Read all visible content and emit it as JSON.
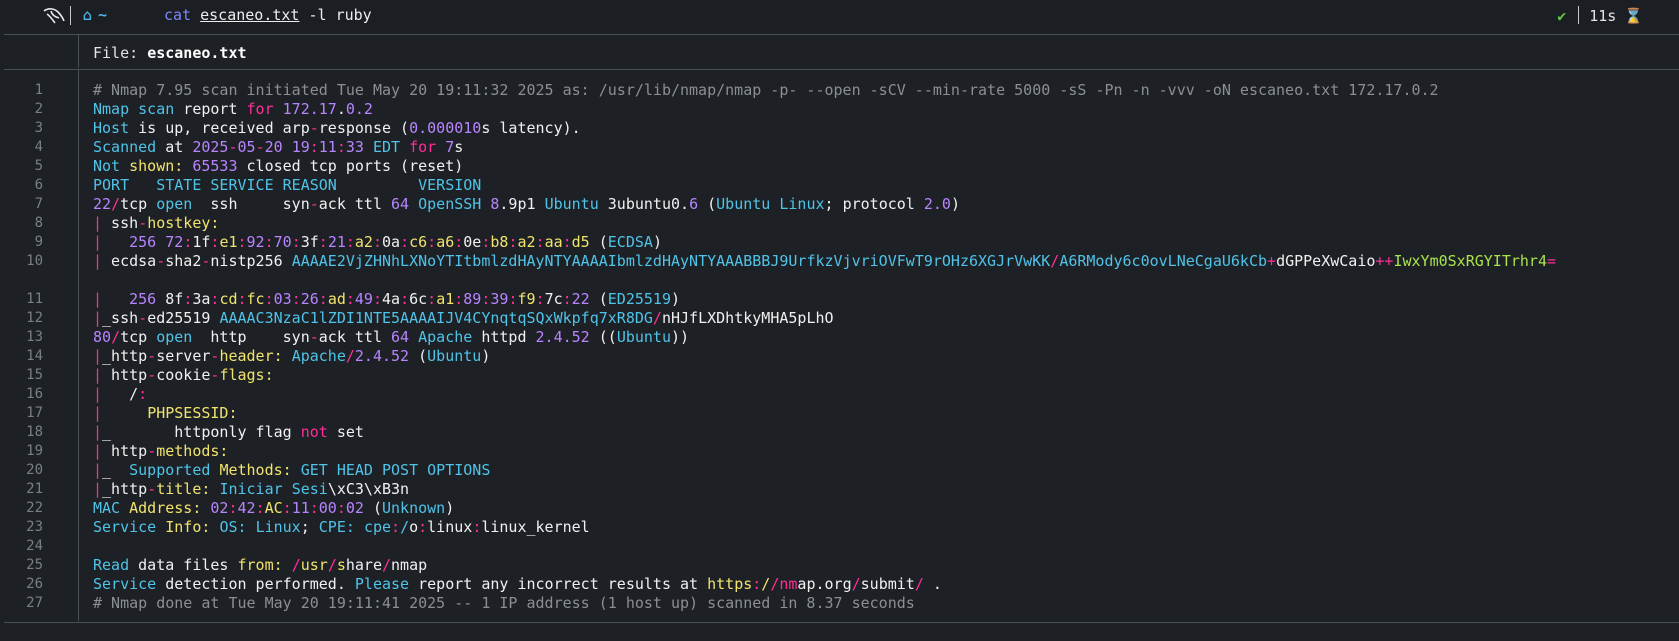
{
  "prompt": {
    "home_icon": "home-icon",
    "tilde": "~",
    "command_cat": "cat",
    "command_file": "escaneo.txt",
    "command_args": " -l ruby",
    "status_check": "✔",
    "duration": "11s",
    "hourglass": "⌛"
  },
  "viewer": {
    "file_label": "File: ",
    "file_name": "escaneo.txt"
  },
  "colors": {
    "keyword": "#4fc3e8",
    "operator": "#ff2e97",
    "number": "#b984ff",
    "property": "#f2e36c",
    "string": "#a9e34b",
    "comment": "#8b8f94"
  },
  "lines": [
    {
      "n": "1",
      "t": [
        [
          "cm",
          "# Nmap 7.95 scan initiated Tue May 20 19:11:32 2025 as: /usr/lib/nmap/nmap -p- --open -sCV --min-rate 5000 -sS -Pn -n -vvv -oN escaneo.txt 172.17.0.2"
        ]
      ]
    },
    {
      "n": "2",
      "t": [
        [
          "k",
          "Nmap"
        ],
        [
          "w",
          " "
        ],
        [
          "k",
          "scan"
        ],
        [
          "w",
          " report "
        ],
        [
          "m",
          "for"
        ],
        [
          "w",
          " "
        ],
        [
          "n",
          "172.17"
        ],
        [
          "w",
          "."
        ],
        [
          "n",
          "0.2"
        ]
      ]
    },
    {
      "n": "3",
      "t": [
        [
          "k",
          "Host"
        ],
        [
          "w",
          " is up, received arp"
        ],
        [
          "m",
          "-"
        ],
        [
          "w",
          "response ("
        ],
        [
          "n",
          "0.000010"
        ],
        [
          "w",
          "s latency)."
        ]
      ]
    },
    {
      "n": "4",
      "t": [
        [
          "k",
          "Scanned"
        ],
        [
          "w",
          " at "
        ],
        [
          "n",
          "2025"
        ],
        [
          "m",
          "-"
        ],
        [
          "n",
          "05"
        ],
        [
          "m",
          "-"
        ],
        [
          "n",
          "20"
        ],
        [
          "w",
          " "
        ],
        [
          "n",
          "19"
        ],
        [
          "m",
          ":"
        ],
        [
          "n",
          "11"
        ],
        [
          "m",
          ":"
        ],
        [
          "n",
          "33"
        ],
        [
          "w",
          " "
        ],
        [
          "k",
          "EDT"
        ],
        [
          "w",
          " "
        ],
        [
          "m",
          "for"
        ],
        [
          "w",
          " "
        ],
        [
          "n",
          "7"
        ],
        [
          "w",
          "s"
        ]
      ]
    },
    {
      "n": "5",
      "t": [
        [
          "k",
          "Not"
        ],
        [
          "w",
          " "
        ],
        [
          "y",
          "shown:"
        ],
        [
          "w",
          " "
        ],
        [
          "n",
          "65533"
        ],
        [
          "w",
          " closed tcp ports (reset)"
        ]
      ]
    },
    {
      "n": "6",
      "t": [
        [
          "k",
          "PORT   STATE SERVICE REASON         VERSION"
        ]
      ]
    },
    {
      "n": "7",
      "t": [
        [
          "n",
          "22"
        ],
        [
          "m",
          "/"
        ],
        [
          "w",
          "tcp "
        ],
        [
          "k",
          "open"
        ],
        [
          "w",
          "  ssh     syn"
        ],
        [
          "m",
          "-"
        ],
        [
          "w",
          "ack ttl "
        ],
        [
          "n",
          "64"
        ],
        [
          "w",
          " "
        ],
        [
          "k",
          "OpenSSH"
        ],
        [
          "w",
          " "
        ],
        [
          "n",
          "8"
        ],
        [
          "w",
          ".9p1 "
        ],
        [
          "k",
          "Ubuntu"
        ],
        [
          "w",
          " 3ubuntu0."
        ],
        [
          "n",
          "6"
        ],
        [
          "w",
          " ("
        ],
        [
          "k",
          "Ubuntu"
        ],
        [
          "w",
          " "
        ],
        [
          "k",
          "Linux"
        ],
        [
          "w",
          "; protocol "
        ],
        [
          "n",
          "2.0"
        ],
        [
          "w",
          ")"
        ]
      ]
    },
    {
      "n": "8",
      "t": [
        [
          "m",
          "|"
        ],
        [
          "w",
          " ssh"
        ],
        [
          "m",
          "-"
        ],
        [
          "y",
          "hostkey:"
        ]
      ]
    },
    {
      "n": "9",
      "t": [
        [
          "m",
          "|"
        ],
        [
          "w",
          "   "
        ],
        [
          "n",
          "256"
        ],
        [
          "w",
          " "
        ],
        [
          "n",
          "72"
        ],
        [
          "m",
          ":"
        ],
        [
          "w",
          "1f"
        ],
        [
          "m",
          ":"
        ],
        [
          "y",
          "e1"
        ],
        [
          "m",
          ":"
        ],
        [
          "n",
          "92"
        ],
        [
          "m",
          ":"
        ],
        [
          "n",
          "70"
        ],
        [
          "m",
          ":"
        ],
        [
          "w",
          "3f"
        ],
        [
          "m",
          ":"
        ],
        [
          "n",
          "21"
        ],
        [
          "m",
          ":"
        ],
        [
          "y",
          "a2"
        ],
        [
          "m",
          ":"
        ],
        [
          "w",
          "0a"
        ],
        [
          "m",
          ":"
        ],
        [
          "y",
          "c6"
        ],
        [
          "m",
          ":"
        ],
        [
          "y",
          "a6"
        ],
        [
          "m",
          ":"
        ],
        [
          "w",
          "0e"
        ],
        [
          "m",
          ":"
        ],
        [
          "y",
          "b8"
        ],
        [
          "m",
          ":"
        ],
        [
          "y",
          "a2"
        ],
        [
          "m",
          ":"
        ],
        [
          "y",
          "aa"
        ],
        [
          "m",
          ":"
        ],
        [
          "y",
          "d5"
        ],
        [
          "w",
          " ("
        ],
        [
          "k",
          "ECDSA"
        ],
        [
          "w",
          ")"
        ]
      ]
    },
    {
      "n": "10",
      "tall": true,
      "t": [
        [
          "m",
          "|"
        ],
        [
          "w",
          " ecdsa"
        ],
        [
          "m",
          "-"
        ],
        [
          "w",
          "sha2"
        ],
        [
          "m",
          "-"
        ],
        [
          "w",
          "nistp256 "
        ],
        [
          "k",
          "AAAAE2VjZHNhLXNoYTItbmlzdHAyNTYAAAAIbmlzdHAyNTYAAABBBJ9UrfkzVjvriOVFwT9rOHz6XGJrVwKK"
        ],
        [
          "m",
          "/"
        ],
        [
          "k",
          "A6RMody6c0ovLNeCgaU6kCb"
        ],
        [
          "m",
          "+"
        ],
        [
          "w",
          "dGPPeXwCaio"
        ],
        [
          "m",
          "++"
        ],
        [
          "g",
          "IwxYm0SxRGYITrhr4"
        ],
        [
          "m",
          "="
        ]
      ]
    },
    {
      "n": "11",
      "t": [
        [
          "m",
          "|"
        ],
        [
          "w",
          "   "
        ],
        [
          "n",
          "256"
        ],
        [
          "w",
          " 8f"
        ],
        [
          "m",
          ":"
        ],
        [
          "w",
          "3a"
        ],
        [
          "m",
          ":"
        ],
        [
          "y",
          "cd"
        ],
        [
          "m",
          ":"
        ],
        [
          "y",
          "fc"
        ],
        [
          "m",
          ":"
        ],
        [
          "n",
          "03"
        ],
        [
          "m",
          ":"
        ],
        [
          "n",
          "26"
        ],
        [
          "m",
          ":"
        ],
        [
          "y",
          "ad"
        ],
        [
          "m",
          ":"
        ],
        [
          "n",
          "49"
        ],
        [
          "m",
          ":"
        ],
        [
          "w",
          "4a"
        ],
        [
          "m",
          ":"
        ],
        [
          "w",
          "6c"
        ],
        [
          "m",
          ":"
        ],
        [
          "y",
          "a1"
        ],
        [
          "m",
          ":"
        ],
        [
          "n",
          "89"
        ],
        [
          "m",
          ":"
        ],
        [
          "n",
          "39"
        ],
        [
          "m",
          ":"
        ],
        [
          "y",
          "f9"
        ],
        [
          "m",
          ":"
        ],
        [
          "w",
          "7c"
        ],
        [
          "m",
          ":"
        ],
        [
          "n",
          "22"
        ],
        [
          "w",
          " ("
        ],
        [
          "k",
          "ED25519"
        ],
        [
          "w",
          ")"
        ]
      ]
    },
    {
      "n": "12",
      "t": [
        [
          "m",
          "|"
        ],
        [
          "w",
          "_ssh"
        ],
        [
          "m",
          "-"
        ],
        [
          "w",
          "ed25519 "
        ],
        [
          "k",
          "AAAAC3NzaC1lZDI1NTE5AAAAIJV4CYnqtqSQxWkpfq7xR8DG"
        ],
        [
          "m",
          "/"
        ],
        [
          "w",
          "nHJfLXDhtkyMHA5pLhO"
        ]
      ]
    },
    {
      "n": "13",
      "t": [
        [
          "n",
          "80"
        ],
        [
          "m",
          "/"
        ],
        [
          "w",
          "tcp "
        ],
        [
          "k",
          "open"
        ],
        [
          "w",
          "  http    syn"
        ],
        [
          "m",
          "-"
        ],
        [
          "w",
          "ack ttl "
        ],
        [
          "n",
          "64"
        ],
        [
          "w",
          " "
        ],
        [
          "k",
          "Apache"
        ],
        [
          "w",
          " httpd "
        ],
        [
          "n",
          "2.4.52"
        ],
        [
          "w",
          " (("
        ],
        [
          "k",
          "Ubuntu"
        ],
        [
          "w",
          "))"
        ]
      ]
    },
    {
      "n": "14",
      "t": [
        [
          "m",
          "|"
        ],
        [
          "w",
          "_http"
        ],
        [
          "m",
          "-"
        ],
        [
          "w",
          "server"
        ],
        [
          "m",
          "-"
        ],
        [
          "y",
          "header:"
        ],
        [
          "w",
          " "
        ],
        [
          "k",
          "Apache"
        ],
        [
          "m",
          "/"
        ],
        [
          "n",
          "2.4.52"
        ],
        [
          "w",
          " ("
        ],
        [
          "k",
          "Ubuntu"
        ],
        [
          "w",
          ")"
        ]
      ]
    },
    {
      "n": "15",
      "t": [
        [
          "m",
          "|"
        ],
        [
          "w",
          " http"
        ],
        [
          "m",
          "-"
        ],
        [
          "w",
          "cookie"
        ],
        [
          "m",
          "-"
        ],
        [
          "y",
          "flags:"
        ]
      ]
    },
    {
      "n": "16",
      "t": [
        [
          "m",
          "|"
        ],
        [
          "w",
          "   /"
        ],
        [
          "m",
          ":"
        ]
      ]
    },
    {
      "n": "17",
      "t": [
        [
          "m",
          "|"
        ],
        [
          "w",
          "     "
        ],
        [
          "y",
          "PHPSESSID:"
        ]
      ]
    },
    {
      "n": "18",
      "t": [
        [
          "m",
          "|"
        ],
        [
          "w",
          "_       httponly flag "
        ],
        [
          "m",
          "not"
        ],
        [
          "w",
          " set"
        ]
      ]
    },
    {
      "n": "19",
      "t": [
        [
          "m",
          "|"
        ],
        [
          "w",
          " http"
        ],
        [
          "m",
          "-"
        ],
        [
          "y",
          "methods:"
        ]
      ]
    },
    {
      "n": "20",
      "t": [
        [
          "m",
          "|"
        ],
        [
          "w",
          "_  "
        ],
        [
          "k",
          "Supported"
        ],
        [
          "w",
          " "
        ],
        [
          "y",
          "Methods:"
        ],
        [
          "w",
          " "
        ],
        [
          "k",
          "GET HEAD POST OPTIONS"
        ]
      ]
    },
    {
      "n": "21",
      "t": [
        [
          "m",
          "|"
        ],
        [
          "w",
          "_http"
        ],
        [
          "m",
          "-"
        ],
        [
          "y",
          "title:"
        ],
        [
          "w",
          " "
        ],
        [
          "k",
          "Iniciar"
        ],
        [
          "w",
          " "
        ],
        [
          "k",
          "Sesi"
        ],
        [
          "w",
          "\\xC3\\xB3n"
        ]
      ]
    },
    {
      "n": "22",
      "t": [
        [
          "k",
          "MAC"
        ],
        [
          "w",
          " "
        ],
        [
          "y",
          "Address:"
        ],
        [
          "w",
          " "
        ],
        [
          "n",
          "02"
        ],
        [
          "m",
          ":"
        ],
        [
          "n",
          "42"
        ],
        [
          "m",
          ":"
        ],
        [
          "y",
          "AC"
        ],
        [
          "m",
          ":"
        ],
        [
          "n",
          "11"
        ],
        [
          "m",
          ":"
        ],
        [
          "n",
          "00"
        ],
        [
          "m",
          ":"
        ],
        [
          "n",
          "02"
        ],
        [
          "w",
          " ("
        ],
        [
          "k",
          "Unknown"
        ],
        [
          "w",
          ")"
        ]
      ]
    },
    {
      "n": "23",
      "t": [
        [
          "k",
          "Service"
        ],
        [
          "w",
          " "
        ],
        [
          "y",
          "Info:"
        ],
        [
          "w",
          " "
        ],
        [
          "k",
          "OS:"
        ],
        [
          "w",
          " "
        ],
        [
          "k",
          "Linux"
        ],
        [
          "w",
          "; "
        ],
        [
          "k",
          "CPE:"
        ],
        [
          "w",
          " "
        ],
        [
          "k",
          "cpe"
        ],
        [
          "m",
          ":"
        ],
        [
          "k",
          "/"
        ],
        [
          "w",
          "o"
        ],
        [
          "m",
          ":"
        ],
        [
          "w",
          "linux"
        ],
        [
          "m",
          ":"
        ],
        [
          "w",
          "linux_kernel"
        ]
      ]
    },
    {
      "n": "24",
      "t": []
    },
    {
      "n": "25",
      "t": [
        [
          "k",
          "Read"
        ],
        [
          "w",
          " data files "
        ],
        [
          "y",
          "from:"
        ],
        [
          "w",
          " "
        ],
        [
          "m",
          "/"
        ],
        [
          "y",
          "usr"
        ],
        [
          "m",
          "/"
        ],
        [
          "y",
          "s"
        ],
        [
          "w",
          "hare"
        ],
        [
          "m",
          "/"
        ],
        [
          "w",
          "nmap"
        ]
      ]
    },
    {
      "n": "26",
      "t": [
        [
          "k",
          "Service"
        ],
        [
          "w",
          " detection performed. "
        ],
        [
          "k",
          "Please"
        ],
        [
          "w",
          " report any incorrect results at "
        ],
        [
          "y",
          "https"
        ],
        [
          "m",
          ":"
        ],
        [
          "y",
          "/"
        ],
        [
          "m",
          "/nm"
        ],
        [
          "w",
          "ap.org"
        ],
        [
          "m",
          "/"
        ],
        [
          "w",
          "submit"
        ],
        [
          "m",
          "/"
        ],
        [
          "w",
          " ."
        ]
      ]
    },
    {
      "n": "27",
      "t": [
        [
          "cm",
          "# Nmap done at Tue May 20 19:11:41 2025 -- 1 IP address (1 host up) scanned in 8.37 seconds"
        ]
      ]
    }
  ]
}
